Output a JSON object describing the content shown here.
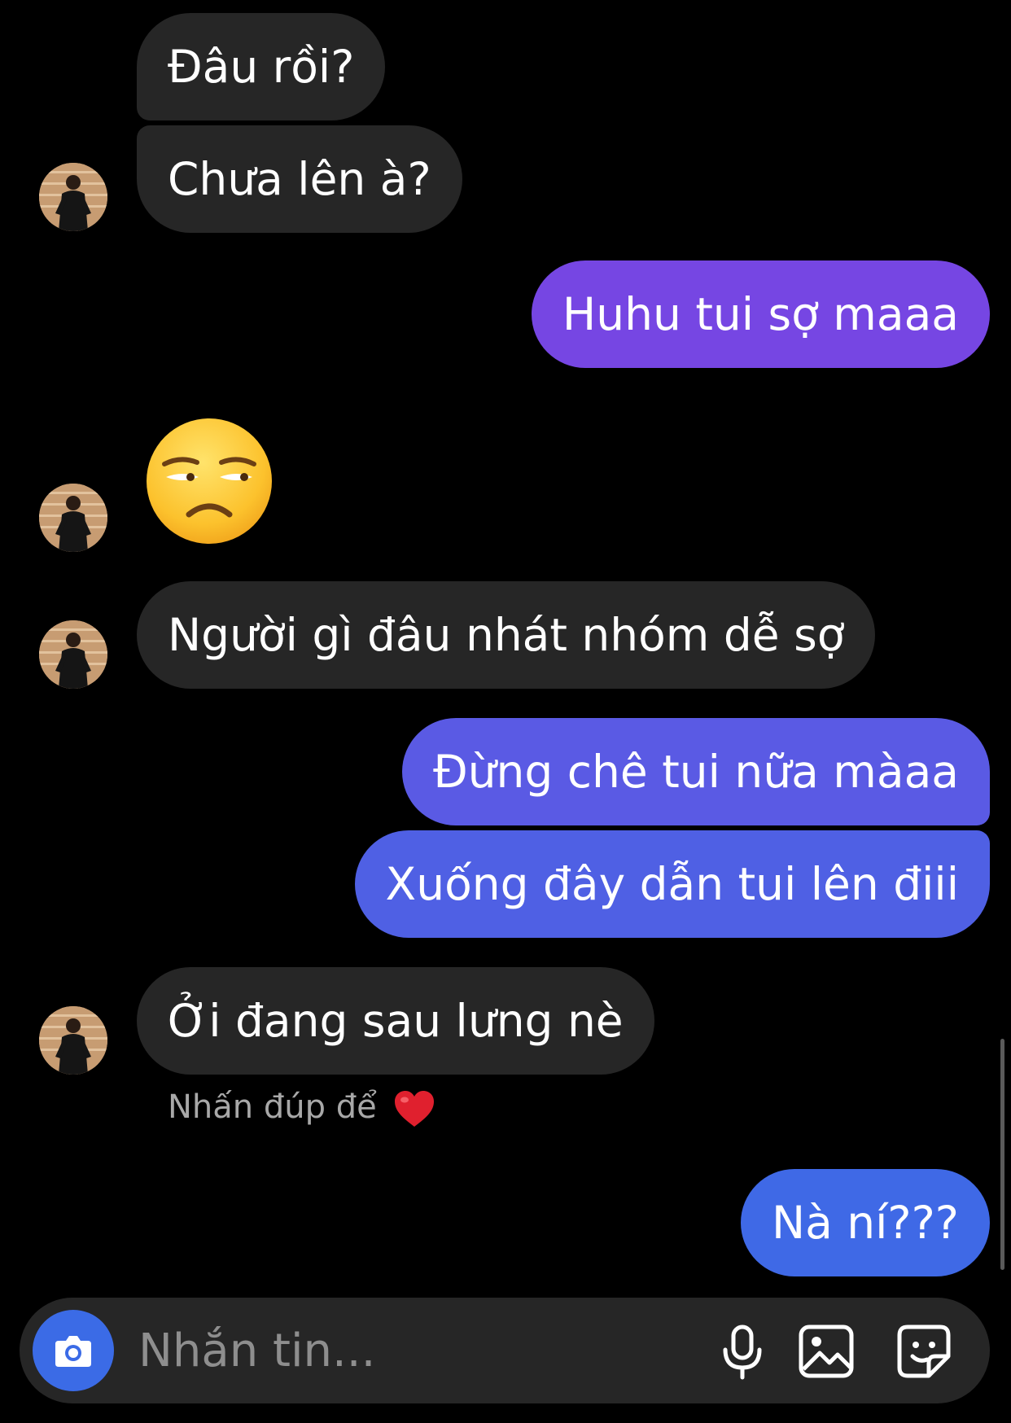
{
  "colors": {
    "background": "#000000",
    "incoming_bubble": "#262626",
    "outgoing_gradient_top": "#7b3fe4",
    "outgoing_gradient_mid": "#5a5fe6",
    "outgoing_gradient_bottom": "#3f6ae8",
    "camera_button": "#3b6be6",
    "placeholder": "#8e8e8e"
  },
  "messages": [
    {
      "id": "m1",
      "direction": "incoming",
      "text": "Đâu rồi?"
    },
    {
      "id": "m2",
      "direction": "incoming",
      "text": "Chưa lên à?"
    },
    {
      "id": "m3",
      "direction": "outgoing",
      "text": "Huhu tui sợ maaa"
    },
    {
      "id": "m4",
      "direction": "incoming",
      "emoji": "unamused-face-emoji"
    },
    {
      "id": "m5",
      "direction": "incoming",
      "text": "Người gì đâu nhát nhóm dễ sợ"
    },
    {
      "id": "m6",
      "direction": "outgoing",
      "text": "Đừng chê tui nữa màaa"
    },
    {
      "id": "m7",
      "direction": "outgoing",
      "text": "Xuống đây dẫn tui lên điii"
    },
    {
      "id": "m8",
      "direction": "incoming",
      "text": "Ởi đang sau lưng nè"
    },
    {
      "id": "m9",
      "direction": "outgoing",
      "text": "Nà ní???"
    }
  ],
  "reaction_hint": {
    "text": "Nhấn đúp để",
    "icon": "red-heart-icon"
  },
  "composer": {
    "placeholder": "Nhắn tin...",
    "value": "",
    "icons": [
      "camera-icon",
      "microphone-icon",
      "gallery-icon",
      "sticker-icon"
    ]
  }
}
